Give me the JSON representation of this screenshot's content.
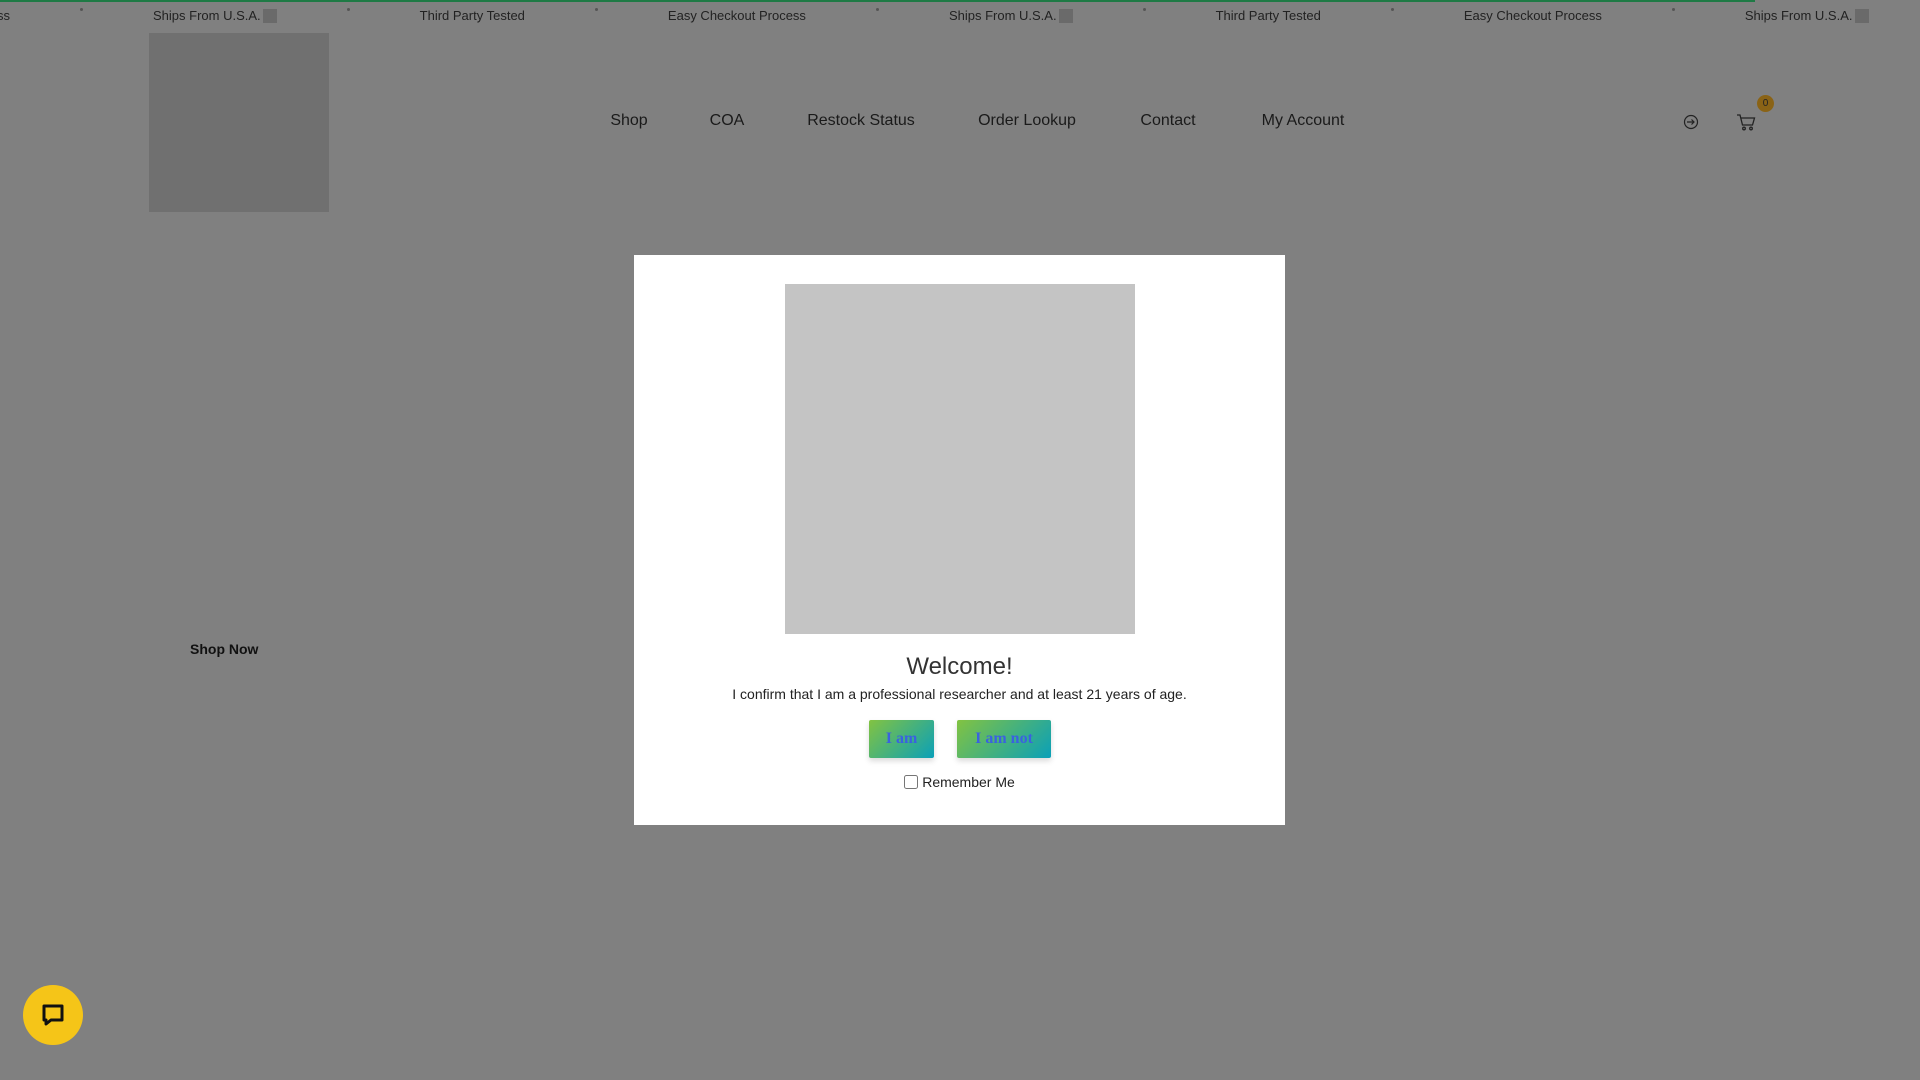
{
  "ticker": {
    "items": [
      "Easy Checkout Process",
      "Ships From U.S.A.",
      "Third Party Tested",
      "Easy Checkout Process",
      "Ships From U.S.A.",
      "Third Party Tested",
      "Easy Checkout Process",
      "Ships From U.S.A.",
      "Third Party Tested",
      "Easy Checkout Process",
      "Ships From U.S.A."
    ]
  },
  "nav": {
    "items": [
      "Shop",
      "COA",
      "Restock Status",
      "Order Lookup",
      "Contact",
      "My Account"
    ]
  },
  "header": {
    "cart_count": "0",
    "icons": [
      "login-icon",
      "cart-icon"
    ]
  },
  "hero": {
    "cta": "Shop Now"
  },
  "modal": {
    "title": "Welcome!",
    "message": "I confirm that I am a professional researcher and at least 21 years of age.",
    "confirm_label": "I am",
    "deny_label": "I am not",
    "remember_label": "Remember Me"
  },
  "colors": {
    "accent_green": "#82c341",
    "accent_teal": "#0aa0b8",
    "button_text": "#3a62e0",
    "chat": "#f5c518"
  }
}
